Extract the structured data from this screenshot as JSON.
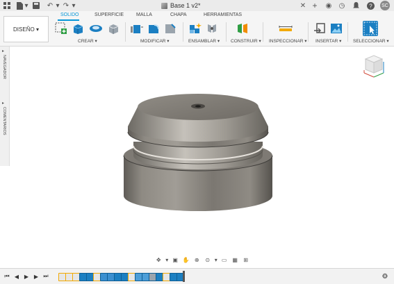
{
  "document": {
    "title": "Base 1 v2*"
  },
  "user": {
    "initials": "SC"
  },
  "workspace": {
    "label": "DISEÑO",
    "caret": "▾"
  },
  "tabs": [
    {
      "label": "SOLIDO",
      "active": true
    },
    {
      "label": "SUPERFICIE",
      "active": false
    },
    {
      "label": "MALLA",
      "active": false
    },
    {
      "label": "CHAPA",
      "active": false
    },
    {
      "label": "HERRAMIENTAS",
      "active": false
    }
  ],
  "groups": [
    {
      "label": "CREAR ▾"
    },
    {
      "label": "MODIFICAR ▾"
    },
    {
      "label": "ENSAMBLAR ▾"
    },
    {
      "label": "CONSTRUIR ▾"
    },
    {
      "label": "INSPECCIONAR ▾"
    },
    {
      "label": "INSERTAR ▾"
    },
    {
      "label": "SELECCIONAR ▾"
    }
  ],
  "side_panel": {
    "navigator": "NAVEGADOR",
    "comments": "COMENTARIOS"
  },
  "colors": {
    "accent": "#0696d7",
    "model_body": "#8a8780"
  }
}
